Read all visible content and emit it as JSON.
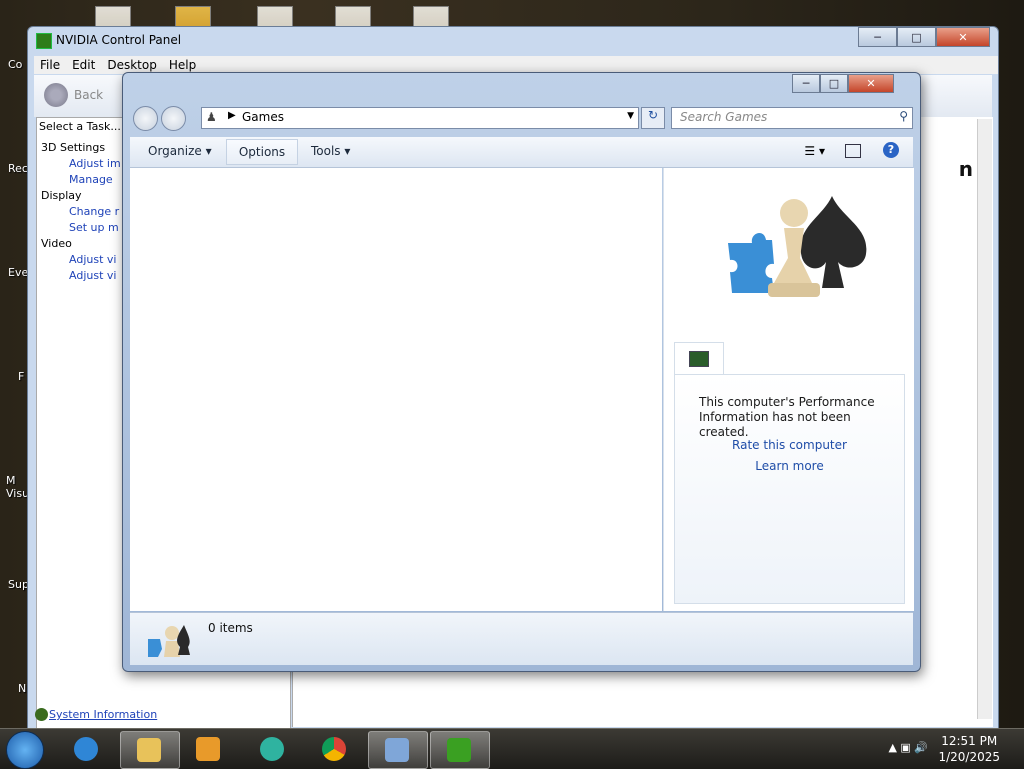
{
  "desktop": {
    "icons": [
      "Co",
      "Rec",
      "Eve",
      "F",
      "M Visu",
      "Sup",
      "N"
    ]
  },
  "nvidia": {
    "title": "NVIDIA Control Panel",
    "menu": [
      "File",
      "Edit",
      "Desktop",
      "Help"
    ],
    "back_label": "Back",
    "select_task": "Select a Task...",
    "tree": [
      {
        "label": "3D Settings",
        "items": [
          "Adjust im",
          "Manage"
        ]
      },
      {
        "label": "Display",
        "items": [
          "Change r",
          "Set up m"
        ]
      },
      {
        "label": "Video",
        "items": [
          "Adjust vi",
          "Adjust vi"
        ]
      }
    ],
    "system_info": "System Information",
    "logo_text": "n"
  },
  "games": {
    "address": "Games",
    "search_placeholder": "Search Games",
    "toolbar": {
      "organize": "Organize",
      "options": "Options",
      "tools": "Tools"
    },
    "perf_text": "This computer's Performance Information has not been created.",
    "rate_link": "Rate this computer",
    "learn_link": "Learn more",
    "status": "0 items"
  },
  "taskbar": {
    "time": "12:51 PM",
    "date": "1/20/2025"
  }
}
